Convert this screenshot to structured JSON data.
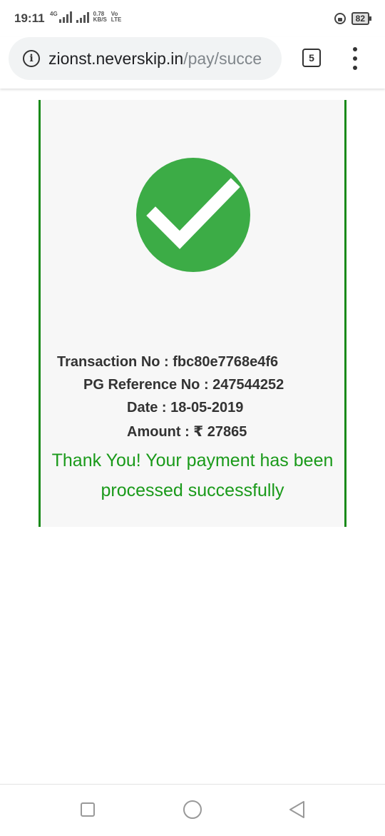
{
  "status_bar": {
    "time": "19:11",
    "network_label": "4G",
    "speed_value": "0.78",
    "speed_unit": "KB/S",
    "volte_top": "Vo",
    "volte_bottom": "LTE",
    "battery": "82"
  },
  "browser": {
    "url_host": "zionst.neverskip.in",
    "url_path": "/pay/succe",
    "tab_count": "5"
  },
  "receipt": {
    "transaction_line": "Transaction No : fbc80e7768e4f6",
    "pg_reference_line": "PG Reference No : 247544252",
    "date_line": "Date : 18-05-2019",
    "amount_line": "Amount : ₹  27865",
    "thanks_line1": "Thank You! Your payment has been",
    "thanks_line2": "processed successfully"
  },
  "icons": {
    "success": "check-circle-icon",
    "info": "info-icon",
    "menu": "more-vert-icon",
    "nav_recents": "square-icon",
    "nav_home": "circle-icon",
    "nav_back": "triangle-back-icon"
  },
  "colors": {
    "success_green": "#3cac46",
    "thanks_text": "#1a9a1a",
    "card_border": "#1a8a1a",
    "card_background": "#f7f7f7"
  }
}
